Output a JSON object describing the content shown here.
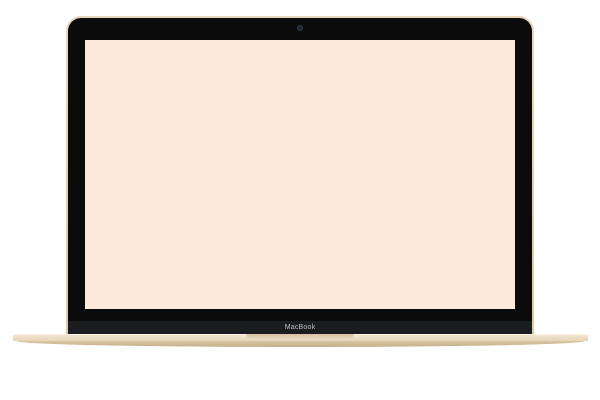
{
  "device": {
    "brand_label": "MacBook",
    "screen_color": "#fbeadb",
    "body_color": "#e7d7bd",
    "bezel_color": "#0b0b0c"
  }
}
